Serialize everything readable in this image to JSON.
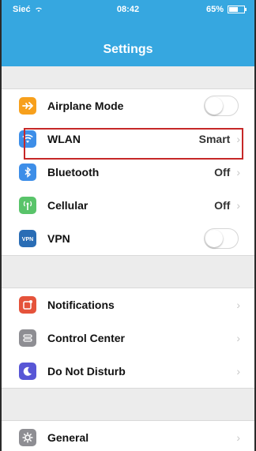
{
  "status_bar": {
    "carrier": "Sieć",
    "time": "08:42",
    "battery": "65%"
  },
  "nav": {
    "title": "Settings"
  },
  "groups": [
    {
      "rows": [
        {
          "label": "Airplane Mode",
          "control": "toggle",
          "icon": "airplane-icon",
          "color": "#f7a01c"
        },
        {
          "label": "WLAN",
          "value": "Smart",
          "icon": "wifi-icon",
          "color": "#3d8ee8",
          "highlighted": true
        },
        {
          "label": "Bluetooth",
          "value": "Off",
          "icon": "bluetooth-icon",
          "color": "#3d8ee8"
        },
        {
          "label": "Cellular",
          "value": "Off",
          "icon": "cellular-icon",
          "color": "#59c46a"
        },
        {
          "label": "VPN",
          "control": "toggle",
          "icon": "vpn-icon",
          "color": "#2a6db5"
        }
      ]
    },
    {
      "rows": [
        {
          "label": "Notifications",
          "icon": "notifications-icon",
          "color": "#e5533b"
        },
        {
          "label": "Control Center",
          "icon": "control-center-icon",
          "color": "#8e8e93"
        },
        {
          "label": "Do Not Disturb",
          "icon": "moon-icon",
          "color": "#5856d6"
        }
      ]
    },
    {
      "rows": [
        {
          "label": "General",
          "icon": "gear-icon",
          "color": "#8e8e93"
        }
      ]
    }
  ]
}
